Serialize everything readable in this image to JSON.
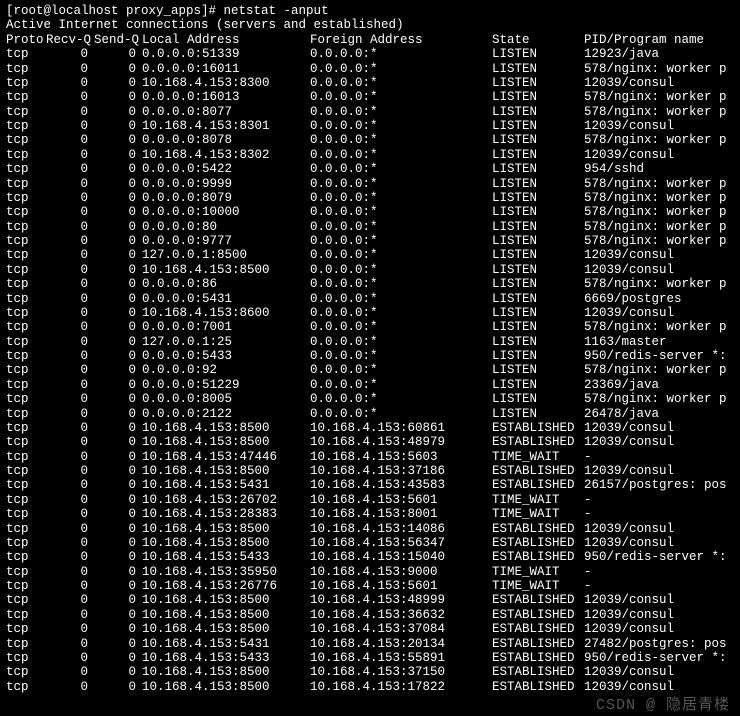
{
  "prompt": "[root@localhost proxy_apps]# ",
  "command": "netstat -anput",
  "subtitle": "Active Internet connections (servers and established)",
  "headers": {
    "proto": "Proto",
    "recvq": "Recv-Q",
    "sendq": "Send-Q",
    "local": "Local Address",
    "foreign": "Foreign Address",
    "state": "State",
    "pid": "PID/Program name"
  },
  "rows": [
    {
      "proto": "tcp",
      "recvq": "0",
      "sendq": "0",
      "local": "0.0.0.0:51339",
      "foreign": "0.0.0.0:*",
      "state": "LISTEN",
      "pid": "12923/java"
    },
    {
      "proto": "tcp",
      "recvq": "0",
      "sendq": "0",
      "local": "0.0.0.0:16011",
      "foreign": "0.0.0.0:*",
      "state": "LISTEN",
      "pid": "578/nginx: worker p"
    },
    {
      "proto": "tcp",
      "recvq": "0",
      "sendq": "0",
      "local": "10.168.4.153:8300",
      "foreign": "0.0.0.0:*",
      "state": "LISTEN",
      "pid": "12039/consul"
    },
    {
      "proto": "tcp",
      "recvq": "0",
      "sendq": "0",
      "local": "0.0.0.0:16013",
      "foreign": "0.0.0.0:*",
      "state": "LISTEN",
      "pid": "578/nginx: worker p"
    },
    {
      "proto": "tcp",
      "recvq": "0",
      "sendq": "0",
      "local": "0.0.0.0:8077",
      "foreign": "0.0.0.0:*",
      "state": "LISTEN",
      "pid": "578/nginx: worker p"
    },
    {
      "proto": "tcp",
      "recvq": "0",
      "sendq": "0",
      "local": "10.168.4.153:8301",
      "foreign": "0.0.0.0:*",
      "state": "LISTEN",
      "pid": "12039/consul"
    },
    {
      "proto": "tcp",
      "recvq": "0",
      "sendq": "0",
      "local": "0.0.0.0:8078",
      "foreign": "0.0.0.0:*",
      "state": "LISTEN",
      "pid": "578/nginx: worker p"
    },
    {
      "proto": "tcp",
      "recvq": "0",
      "sendq": "0",
      "local": "10.168.4.153:8302",
      "foreign": "0.0.0.0:*",
      "state": "LISTEN",
      "pid": "12039/consul"
    },
    {
      "proto": "tcp",
      "recvq": "0",
      "sendq": "0",
      "local": "0.0.0.0:5422",
      "foreign": "0.0.0.0:*",
      "state": "LISTEN",
      "pid": "954/sshd"
    },
    {
      "proto": "tcp",
      "recvq": "0",
      "sendq": "0",
      "local": "0.0.0.0:9999",
      "foreign": "0.0.0.0:*",
      "state": "LISTEN",
      "pid": "578/nginx: worker p"
    },
    {
      "proto": "tcp",
      "recvq": "0",
      "sendq": "0",
      "local": "0.0.0.0:8079",
      "foreign": "0.0.0.0:*",
      "state": "LISTEN",
      "pid": "578/nginx: worker p"
    },
    {
      "proto": "tcp",
      "recvq": "0",
      "sendq": "0",
      "local": "0.0.0.0:10000",
      "foreign": "0.0.0.0:*",
      "state": "LISTEN",
      "pid": "578/nginx: worker p"
    },
    {
      "proto": "tcp",
      "recvq": "0",
      "sendq": "0",
      "local": "0.0.0.0:80",
      "foreign": "0.0.0.0:*",
      "state": "LISTEN",
      "pid": "578/nginx: worker p"
    },
    {
      "proto": "tcp",
      "recvq": "0",
      "sendq": "0",
      "local": "0.0.0.0:9777",
      "foreign": "0.0.0.0:*",
      "state": "LISTEN",
      "pid": "578/nginx: worker p"
    },
    {
      "proto": "tcp",
      "recvq": "0",
      "sendq": "0",
      "local": "127.0.0.1:8500",
      "foreign": "0.0.0.0:*",
      "state": "LISTEN",
      "pid": "12039/consul"
    },
    {
      "proto": "tcp",
      "recvq": "0",
      "sendq": "0",
      "local": "10.168.4.153:8500",
      "foreign": "0.0.0.0:*",
      "state": "LISTEN",
      "pid": "12039/consul"
    },
    {
      "proto": "tcp",
      "recvq": "0",
      "sendq": "0",
      "local": "0.0.0.0:86",
      "foreign": "0.0.0.0:*",
      "state": "LISTEN",
      "pid": "578/nginx: worker p"
    },
    {
      "proto": "tcp",
      "recvq": "0",
      "sendq": "0",
      "local": "0.0.0.0:5431",
      "foreign": "0.0.0.0:*",
      "state": "LISTEN",
      "pid": "6669/postgres"
    },
    {
      "proto": "tcp",
      "recvq": "0",
      "sendq": "0",
      "local": "10.168.4.153:8600",
      "foreign": "0.0.0.0:*",
      "state": "LISTEN",
      "pid": "12039/consul"
    },
    {
      "proto": "tcp",
      "recvq": "0",
      "sendq": "0",
      "local": "0.0.0.0:7001",
      "foreign": "0.0.0.0:*",
      "state": "LISTEN",
      "pid": "578/nginx: worker p"
    },
    {
      "proto": "tcp",
      "recvq": "0",
      "sendq": "0",
      "local": "127.0.0.1:25",
      "foreign": "0.0.0.0:*",
      "state": "LISTEN",
      "pid": "1163/master"
    },
    {
      "proto": "tcp",
      "recvq": "0",
      "sendq": "0",
      "local": "0.0.0.0:5433",
      "foreign": "0.0.0.0:*",
      "state": "LISTEN",
      "pid": "950/redis-server *:"
    },
    {
      "proto": "tcp",
      "recvq": "0",
      "sendq": "0",
      "local": "0.0.0.0:92",
      "foreign": "0.0.0.0:*",
      "state": "LISTEN",
      "pid": "578/nginx: worker p"
    },
    {
      "proto": "tcp",
      "recvq": "0",
      "sendq": "0",
      "local": "0.0.0.0:51229",
      "foreign": "0.0.0.0:*",
      "state": "LISTEN",
      "pid": "23369/java"
    },
    {
      "proto": "tcp",
      "recvq": "0",
      "sendq": "0",
      "local": "0.0.0.0:8005",
      "foreign": "0.0.0.0:*",
      "state": "LISTEN",
      "pid": "578/nginx: worker p"
    },
    {
      "proto": "tcp",
      "recvq": "0",
      "sendq": "0",
      "local": "0.0.0.0:2122",
      "foreign": "0.0.0.0:*",
      "state": "LISTEN",
      "pid": "26478/java"
    },
    {
      "proto": "tcp",
      "recvq": "0",
      "sendq": "0",
      "local": "10.168.4.153:8500",
      "foreign": "10.168.4.153:60861",
      "state": "ESTABLISHED",
      "pid": "12039/consul"
    },
    {
      "proto": "tcp",
      "recvq": "0",
      "sendq": "0",
      "local": "10.168.4.153:8500",
      "foreign": "10.168.4.153:48979",
      "state": "ESTABLISHED",
      "pid": "12039/consul"
    },
    {
      "proto": "tcp",
      "recvq": "0",
      "sendq": "0",
      "local": "10.168.4.153:47446",
      "foreign": "10.168.4.153:5603",
      "state": "TIME_WAIT",
      "pid": "-"
    },
    {
      "proto": "tcp",
      "recvq": "0",
      "sendq": "0",
      "local": "10.168.4.153:8500",
      "foreign": "10.168.4.153:37186",
      "state": "ESTABLISHED",
      "pid": "12039/consul"
    },
    {
      "proto": "tcp",
      "recvq": "0",
      "sendq": "0",
      "local": "10.168.4.153:5431",
      "foreign": "10.168.4.153:43583",
      "state": "ESTABLISHED",
      "pid": "26157/postgres: pos"
    },
    {
      "proto": "tcp",
      "recvq": "0",
      "sendq": "0",
      "local": "10.168.4.153:26702",
      "foreign": "10.168.4.153:5601",
      "state": "TIME_WAIT",
      "pid": "-"
    },
    {
      "proto": "tcp",
      "recvq": "0",
      "sendq": "0",
      "local": "10.168.4.153:28383",
      "foreign": "10.168.4.153:8001",
      "state": "TIME_WAIT",
      "pid": "-"
    },
    {
      "proto": "tcp",
      "recvq": "0",
      "sendq": "0",
      "local": "10.168.4.153:8500",
      "foreign": "10.168.4.153:14086",
      "state": "ESTABLISHED",
      "pid": "12039/consul"
    },
    {
      "proto": "tcp",
      "recvq": "0",
      "sendq": "0",
      "local": "10.168.4.153:8500",
      "foreign": "10.168.4.153:56347",
      "state": "ESTABLISHED",
      "pid": "12039/consul"
    },
    {
      "proto": "tcp",
      "recvq": "0",
      "sendq": "0",
      "local": "10.168.4.153:5433",
      "foreign": "10.168.4.153:15040",
      "state": "ESTABLISHED",
      "pid": "950/redis-server *:"
    },
    {
      "proto": "tcp",
      "recvq": "0",
      "sendq": "0",
      "local": "10.168.4.153:35950",
      "foreign": "10.168.4.153:9000",
      "state": "TIME_WAIT",
      "pid": "-"
    },
    {
      "proto": "tcp",
      "recvq": "0",
      "sendq": "0",
      "local": "10.168.4.153:26776",
      "foreign": "10.168.4.153:5601",
      "state": "TIME_WAIT",
      "pid": "-"
    },
    {
      "proto": "tcp",
      "recvq": "0",
      "sendq": "0",
      "local": "10.168.4.153:8500",
      "foreign": "10.168.4.153:48999",
      "state": "ESTABLISHED",
      "pid": "12039/consul"
    },
    {
      "proto": "tcp",
      "recvq": "0",
      "sendq": "0",
      "local": "10.168.4.153:8500",
      "foreign": "10.168.4.153:36632",
      "state": "ESTABLISHED",
      "pid": "12039/consul"
    },
    {
      "proto": "tcp",
      "recvq": "0",
      "sendq": "0",
      "local": "10.168.4.153:8500",
      "foreign": "10.168.4.153:37084",
      "state": "ESTABLISHED",
      "pid": "12039/consul"
    },
    {
      "proto": "tcp",
      "recvq": "0",
      "sendq": "0",
      "local": "10.168.4.153:5431",
      "foreign": "10.168.4.153:20134",
      "state": "ESTABLISHED",
      "pid": "27482/postgres: pos"
    },
    {
      "proto": "tcp",
      "recvq": "0",
      "sendq": "0",
      "local": "10.168.4.153:5433",
      "foreign": "10.168.4.153:55891",
      "state": "ESTABLISHED",
      "pid": "950/redis-server *:"
    },
    {
      "proto": "tcp",
      "recvq": "0",
      "sendq": "0",
      "local": "10.168.4.153:8500",
      "foreign": "10.168.4.153:37150",
      "state": "ESTABLISHED",
      "pid": "12039/consul"
    },
    {
      "proto": "tcp",
      "recvq": "0",
      "sendq": "0",
      "local": "10.168.4.153:8500",
      "foreign": "10.168.4.153:17822",
      "state": "ESTABLISHED",
      "pid": "12039/consul"
    }
  ],
  "watermark": "CSDN @ 隐居青楼"
}
